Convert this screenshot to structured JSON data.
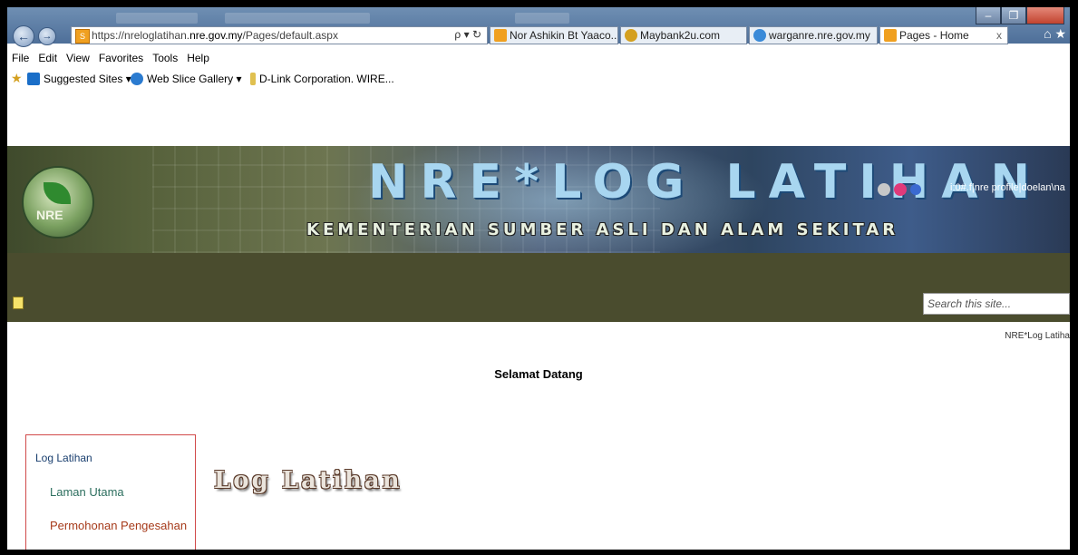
{
  "browser": {
    "address_url_prefix": "https://nreloglatihan.",
    "address_url_domain": "nre.gov.my",
    "address_url_path": "/Pages/default.aspx",
    "address_tools": "ρ ▾ ↻",
    "tabs": [
      {
        "label": "Nor Ashikin Bt Yaaco...",
        "icon_color": "#f0a020"
      },
      {
        "label": "Maybank2u.com",
        "icon_color": "#d4a020"
      },
      {
        "label": "warganre.nre.gov.my",
        "icon_color": "#3a8ad8"
      },
      {
        "label": "Pages - Home",
        "icon_color": "#f0a020",
        "close": "x"
      }
    ],
    "menu": [
      "File",
      "Edit",
      "View",
      "Favorites",
      "Tools",
      "Help"
    ],
    "favorites": [
      {
        "label": "Suggested Sites ▾",
        "icon_color": "#1a6ec8"
      },
      {
        "label": "Web Slice Gallery ▾",
        "icon_color": "#2b7bd0"
      },
      {
        "label": "D-Link Corporation. WIRE...",
        "icon_color": "#e0c050"
      }
    ]
  },
  "site": {
    "logo_text": "NRE",
    "title": "NRE*LOG LATIHAN",
    "subtitle": "KEMENTERIAN SUMBER ASLI DAN ALAM SEKITAR",
    "user": "i:0#.f|nre profile|doelan\\na",
    "search_placeholder": "Search this site...",
    "breadcrumb": "NRE*Log Latiha",
    "welcome": "Selamat Datang",
    "left_nav": {
      "heading": "Log Latihan",
      "items": [
        "Laman Utama",
        "Permohonan Pengesahan"
      ]
    },
    "page_heading": "Log Latihan"
  }
}
